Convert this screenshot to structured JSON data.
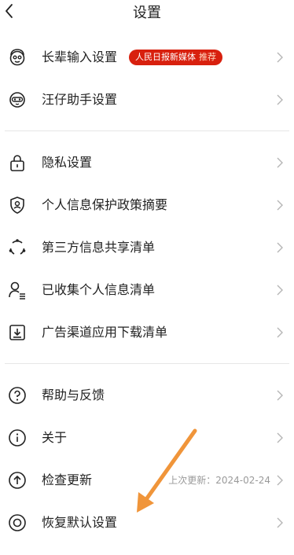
{
  "header": {
    "title": "设置"
  },
  "groups": [
    {
      "items": [
        {
          "label": "长辈输入设置",
          "icon": "elder-face-icon",
          "badge": "人民日报新媒体",
          "badge_suffix": "推荐"
        },
        {
          "label": "汪仔助手设置",
          "icon": "mascot-icon"
        }
      ]
    },
    {
      "items": [
        {
          "label": "隐私设置",
          "icon": "lock-icon"
        },
        {
          "label": "个人信息保护政策摘要",
          "icon": "shield-user-icon"
        },
        {
          "label": "第三方信息共享清单",
          "icon": "share-nodes-icon"
        },
        {
          "label": "已收集个人信息清单",
          "icon": "user-list-icon"
        },
        {
          "label": "广告渠道应用下载清单",
          "icon": "download-box-icon"
        }
      ]
    },
    {
      "items": [
        {
          "label": "帮助与反馈",
          "icon": "help-circle-icon"
        },
        {
          "label": "关于",
          "icon": "info-circle-icon"
        },
        {
          "label": "检查更新",
          "icon": "upload-circle-icon",
          "meta": "上次更新：2024-02-24"
        },
        {
          "label": "恢复默认设置",
          "icon": "restore-circle-icon"
        }
      ]
    }
  ],
  "annotation": {
    "arrow_color": "#f0953a"
  }
}
